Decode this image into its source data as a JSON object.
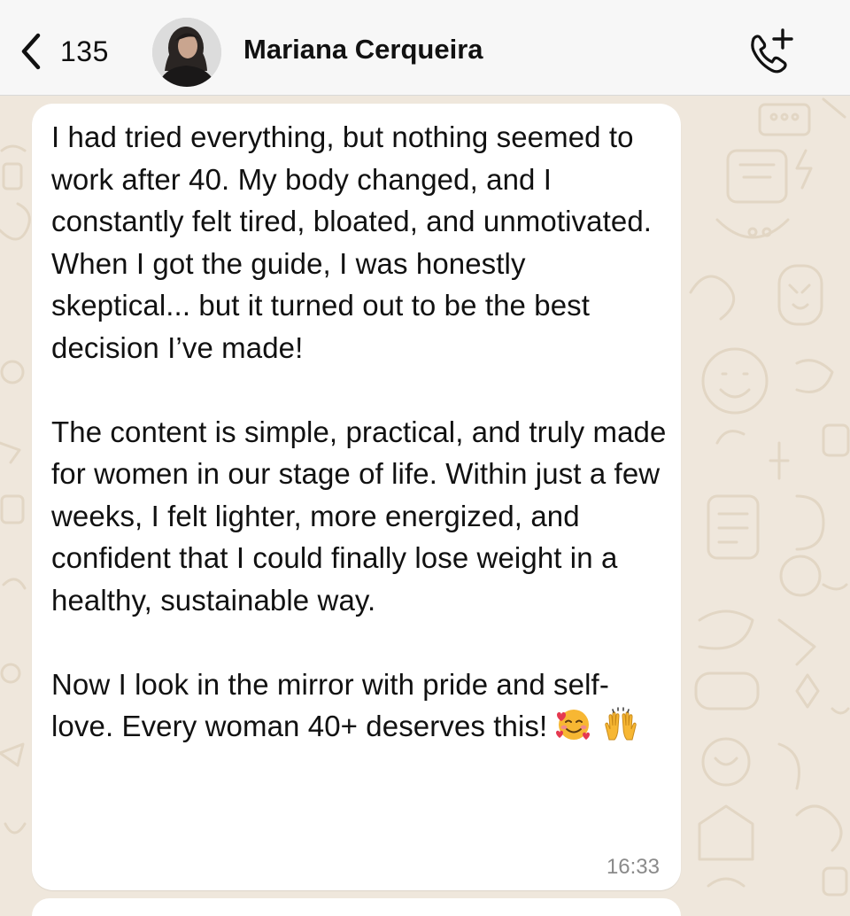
{
  "header": {
    "back_count": "135",
    "contact_name": "Mariana Cerqueira",
    "back_icon": "chevron-left-icon",
    "call_icon": "phone-add-icon"
  },
  "message": {
    "paragraphs": [
      "I had tried everything, but nothing seemed to work after 40. My body changed, and I constantly felt tired, bloated, and unmotivated. When I got the guide, I was honestly skeptical... but it turned out to be the best decision I’ve made!",
      "The content is simple, practical, and truly made for women in our stage of life. Within just a few weeks, I felt lighter, more energized, and confident that I could finally lose weight in a healthy, sustainable way.",
      "Now I look in the mirror with pride and self-love. Every woman 40+ deserves this!"
    ],
    "emojis": [
      "smiling-face-with-hearts",
      "raising-hands"
    ],
    "time": "16:33"
  },
  "colors": {
    "wallpaper": "#efe7dc",
    "header_bg": "#f7f7f7",
    "bubble_bg": "#ffffff",
    "timestamp": "#8a8a8a"
  }
}
